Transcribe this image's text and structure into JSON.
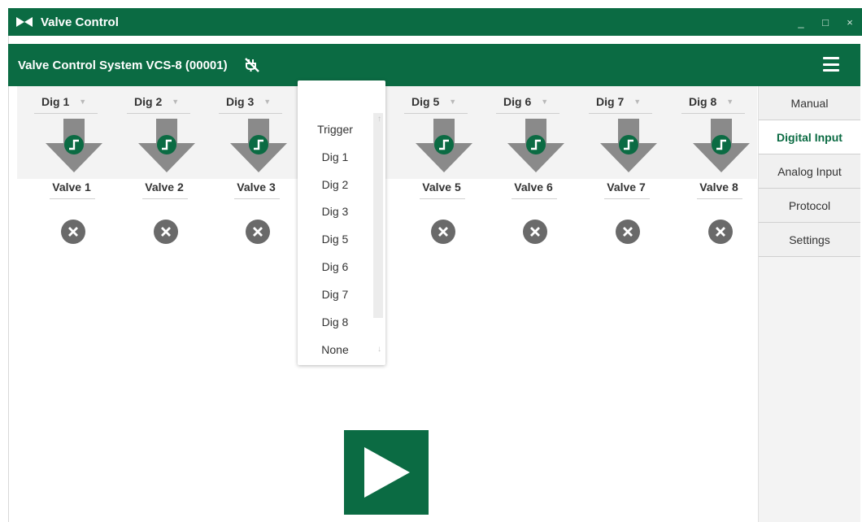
{
  "window": {
    "title": "Valve Control",
    "controls": [
      "_",
      "□",
      "×"
    ]
  },
  "header": {
    "title": "Valve Control System VCS-8 (00001)",
    "status_icon": "disconnected-plug-icon",
    "menu_icon": "hamburger-menu-icon"
  },
  "channels": [
    {
      "input": "Dig 1",
      "valve": "Valve 1"
    },
    {
      "input": "Dig 2",
      "valve": "Valve 2"
    },
    {
      "input": "Dig 3",
      "valve": "Valve 3"
    },
    {
      "input": "",
      "valve": ""
    },
    {
      "input": "Dig 5",
      "valve": "Valve 5"
    },
    {
      "input": "Dig 6",
      "valve": "Valve 6"
    },
    {
      "input": "Dig 7",
      "valve": "Valve 7"
    },
    {
      "input": "Dig 8",
      "valve": "Valve 8"
    }
  ],
  "dropdown": {
    "options": [
      "Trigger",
      "Dig 1",
      "Dig 2",
      "Dig 3",
      "Dig 5",
      "Dig 6",
      "Dig 7",
      "Dig 8",
      "None"
    ]
  },
  "sidebar": {
    "tabs": [
      "Manual",
      "Digital Input",
      "Analog Input",
      "Protocol",
      "Settings"
    ],
    "active": "Digital Input"
  },
  "colors": {
    "brand": "#0b6b43",
    "arrow": "#8a8a8a",
    "status_closed": "#6a6a6a"
  },
  "play_icon": "play-icon"
}
